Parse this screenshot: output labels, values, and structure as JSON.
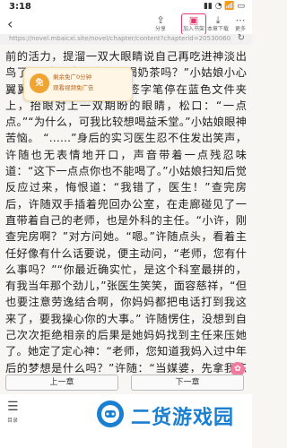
{
  "status_bar": {
    "time": "3:18",
    "system": "▮▮ ◔ 📶 ▭"
  },
  "toolbar": {
    "back_icon": "back-arrow-icon",
    "items": [
      {
        "icon": "share-icon",
        "label": "分享"
      },
      {
        "icon": "bookshelf-icon",
        "label": "加入书架"
      },
      {
        "icon": "download-icon",
        "label": "本章下载"
      },
      {
        "icon": "more-icon",
        "label": "更多"
      }
    ]
  },
  "url_bar": {
    "url": "https://novel.mbaicxi.site/novel/chapter/content?chapterid=20530060",
    "reload_icon": "reload-icon"
  },
  "toast": {
    "badge": "免",
    "line1": "剩余免广0分钟",
    "line2": "观看视频免广告"
  },
  "chapter_text": "前的活力，提溜一双大眼睛说自己再吃进神淡出鸟了。“许医生，我可以喝奶茶吗？”小姑娘小心翼翼地问道。 许随拿着签字笔停在蓝色文件夹上，抬眼对上一双期盼的眼睛，松口：“一点点。”“为什么，可我比较想喝益禾堂。”小姑娘眼神苦恼。 “……”身后的实习医生忍不住发出笑声，许随也无表情地开口，声音带着一点残忍味道：“这下一点点你也不能喝了。”小姑娘扫知后觉反应过来，悔恨道：“我错了，医生！”查完房后，许随双手插着兜回办公室，在走廊碰见了一直带着自己的老师，也是外科的主任。“小许，刚查完房啊？”对方问她。“嗯。”许随点头，看着主任好像有什么话要说，便主动问，“老师，您有什么事吗？”“你最近确实忙，是这个科室最拼的，有我当年那个劲儿，”张医生笑笑，面容慈祥，“但也要注意劳逸结合啊，你妈妈都把电话打到我这来了，要我操心你的大事。” 许随愣住，没想到自己次次拒绝相亲的后果是她妈妈找到主任来压她了。她定了定心神：“老师，您知道我妈入过中年后的梦想是什么吗？”许随：“当媒婆，先拿我练手。”许随用手指向远方：“你那边孩子呢，哥哥，加油，以后在工作，许随了",
  "float_icon": "gift-icon",
  "nav": {
    "prev_label": "上一章",
    "next_label": "下一章"
  },
  "bottom_nav": {
    "menu_icon": "hamburger-menu-icon",
    "menu_label": "目录"
  },
  "watermark": {
    "brand_text": "二货游戏园",
    "logo_icon": "brand-logo-icon"
  }
}
